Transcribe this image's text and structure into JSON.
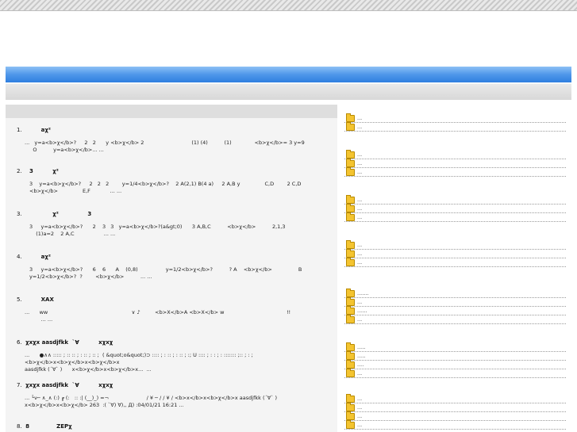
{
  "entries": [
    {
      "num": "1.",
      "title": "        aχ²",
      "body": "...   y=a<b>χ</b>?     2   2      y <b>χ</b> 2                             (1) (4)          (1)              <b>χ</b>= 3 y=9\n     O          y=a<b>χ</b>... ..."
    },
    {
      "num": "2.",
      "title": "  3          χ²",
      "body": "3    y=a<b>χ</b>?     2   2   2        y=1/4<b>χ</b>?    2 A(2,1) B(4 a)     2 A,B y               C,D        2 C,D\n<b>χ</b>               E,F            ... ..."
    },
    {
      "num": "3.",
      "title": "              χ²               3",
      "body": "3     y=a<b>χ</b>?      2    3   3   y=a<b>χ</b>?(a&gt;0)      3 A,B,C          <b>χ</b>          2,1,3\n    (1)a=2    2 A,C                  ... ..."
    },
    {
      "num": "4.",
      "title": "        aχ²",
      "body": "3     y=a<b>χ</b>?      6    6      A    (0,8)                 y=1/2<b>χ</b>?          ? A    <b>χ</b>                B\ny=1/2<b>χ</b>?  ?        <b>χ</b>          ... ..."
    },
    {
      "num": "5.",
      "title": "        XAX",
      "body": "...      ww                                                   ∨ ♪         <b>X</b>A <b>X</b> w                                      !!\n          ... ..."
    },
    {
      "num": "6.",
      "title": "χxχx aasdjfkk  `∀          xχxχ",
      "body": "...      ●∧∧ ::::: ; :: :: ; : :: ; :: ;  ( &quot;o&quot;)⊃ :::: ; : :: ; : :: ; :; U :::: ; : : ; : ::::::: ;:: ; : ;                <b>χ</b>x<b>χ</b>x<b>χ</b>x\naasdjfkk (´∀` )      x<b>χ</b>x<b>χ</b>x...  ..."
    },
    {
      "num": "7.",
      "title": "χxχx aasdjfkk  `∀          xχxχ",
      "body": "... └ν─ ∧_∧ (:) ┏ (:   :: :| (__)_) =¬                       / ¥ ─ / / ¥ / <b>x</b>x<b>χ</b>x aasdjfkk (´∀` )\nx<b>χ</b>x<b>χ</b> 263  :( `∀) ∀),, Д) :04/01/21 16:21 ..."
    },
    {
      "num": "8.",
      "title": "8              ZEPχ",
      "body": ""
    }
  ],
  "sidebar_groups": [
    [
      "...",
      "..."
    ],
    [
      "...",
      "...",
      "..."
    ],
    [
      "...",
      "...",
      "..."
    ],
    [
      "...",
      "...",
      "..."
    ],
    [
      ".......",
      "...",
      "......",
      "..."
    ],
    [
      ".....",
      ".....",
      "....",
      "..."
    ],
    [
      "...",
      "...",
      "...",
      "..."
    ]
  ]
}
